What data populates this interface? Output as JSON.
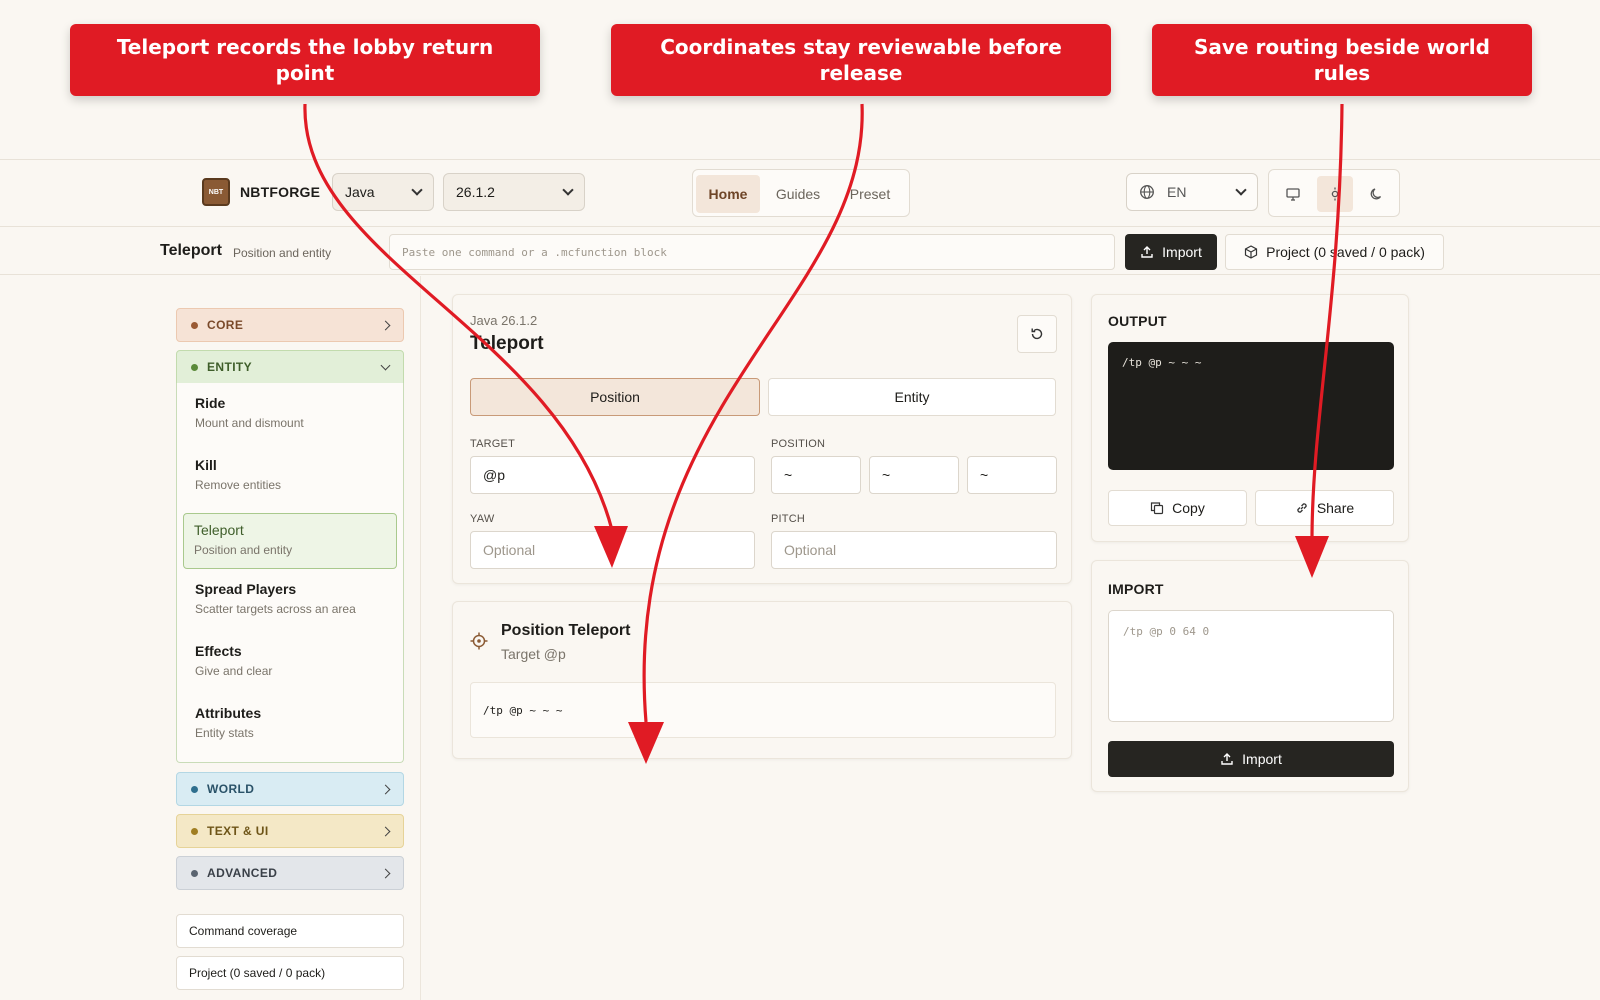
{
  "callouts": [
    "Teleport records the lobby return point",
    "Coordinates stay reviewable before release",
    "Save routing beside world rules"
  ],
  "header": {
    "logo_text": "NBT",
    "brand": "NBTFORGE",
    "edition_select": "Java",
    "version_select": "26.1.2",
    "nav": [
      "Home",
      "Guides",
      "Preset"
    ],
    "active_nav": "Home",
    "language_select": "EN"
  },
  "subbar": {
    "title": "Teleport",
    "subtitle": "Position and entity",
    "command_placeholder": "Paste one command or a .mcfunction block",
    "import_label": "Import",
    "project_label": "Project (0 saved / 0 pack)"
  },
  "sidebar": {
    "categories": {
      "core": "CORE",
      "entity": "ENTITY",
      "world": "WORLD",
      "text_ui": "TEXT & UI",
      "advanced": "ADVANCED"
    },
    "entity_items": [
      {
        "title": "Ride",
        "subtitle": "Mount and dismount"
      },
      {
        "title": "Kill",
        "subtitle": "Remove entities"
      },
      {
        "title": "Teleport",
        "subtitle": "Position and entity"
      },
      {
        "title": "Spread Players",
        "subtitle": "Scatter targets across an area"
      },
      {
        "title": "Effects",
        "subtitle": "Give and clear"
      },
      {
        "title": "Attributes",
        "subtitle": "Entity stats"
      }
    ],
    "links": [
      "Command coverage",
      "Project (0 saved / 0 pack)"
    ]
  },
  "editor": {
    "version_label": "Java 26.1.2",
    "title": "Teleport",
    "tabs": [
      "Position",
      "Entity"
    ],
    "active_tab": "Position",
    "target_label": "TARGET",
    "target_value": "@p",
    "position_label": "POSITION",
    "position_values": [
      "~",
      "~",
      "~"
    ],
    "yaw_label": "YAW",
    "yaw_placeholder": "Optional",
    "pitch_label": "PITCH",
    "pitch_placeholder": "Optional"
  },
  "summary": {
    "title": "Position Teleport",
    "subtitle": "Target @p",
    "command": "/tp @p ~ ~ ~"
  },
  "output": {
    "heading": "OUTPUT",
    "command": "/tp @p ~ ~ ~",
    "copy_label": "Copy",
    "share_label": "Share"
  },
  "import_panel": {
    "heading": "IMPORT",
    "placeholder": "/tp @p 0 64 0",
    "button_label": "Import"
  },
  "colors": {
    "callout": "#e01b24",
    "core": "#f6e3d6",
    "entity": "#e2efd8",
    "world": "#d9ecf3",
    "text_ui": "#f4e8c6",
    "advanced": "#e3e6ea",
    "dark": "#1e1d1a"
  }
}
